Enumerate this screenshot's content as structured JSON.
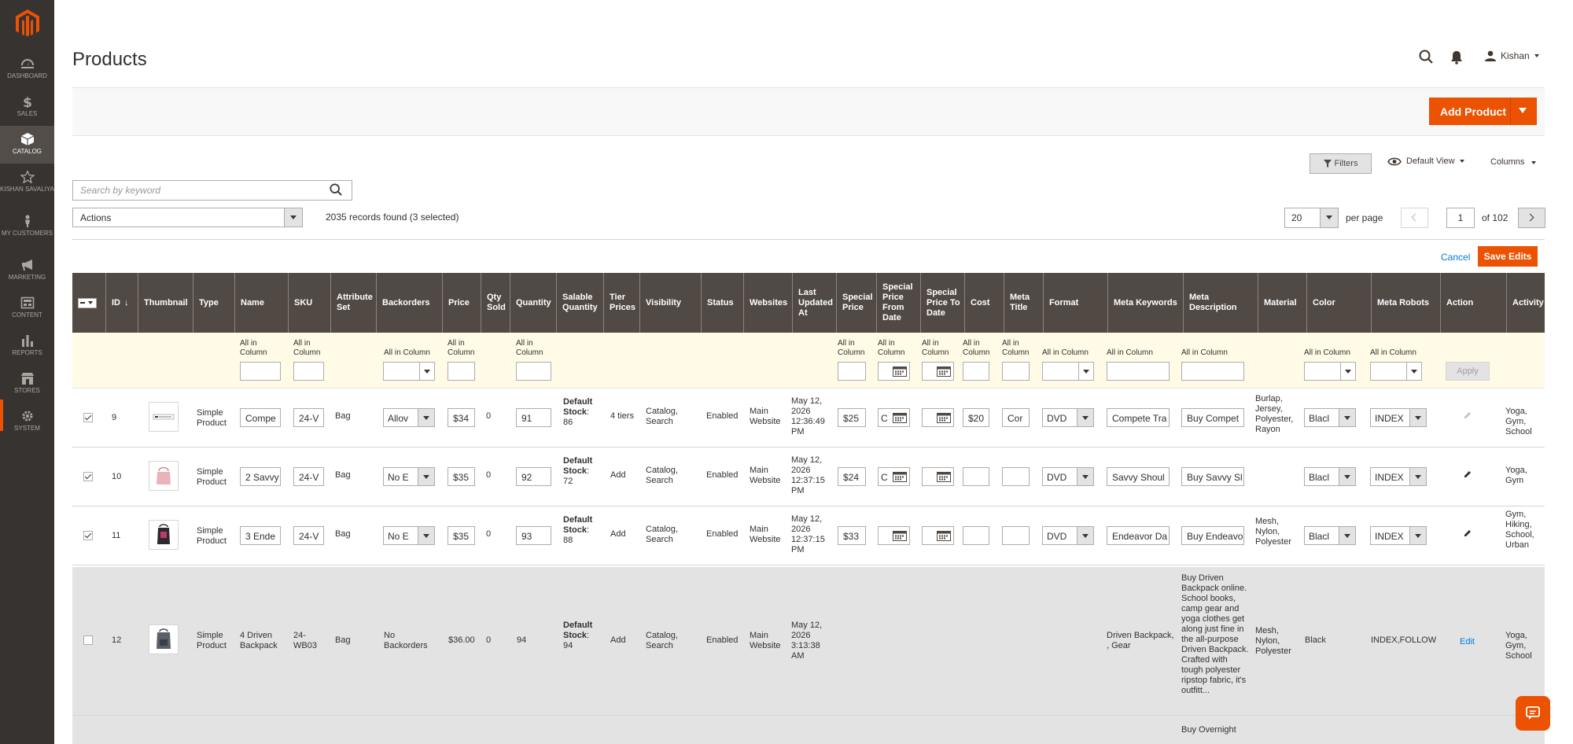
{
  "sidebar": {
    "items": [
      {
        "label": "DASHBOARD",
        "icon": "dashboard-icon"
      },
      {
        "label": "SALES",
        "icon": "dollar-icon"
      },
      {
        "label": "CATALOG",
        "icon": "box-icon"
      },
      {
        "label": "KISHAN SAVALIYA",
        "icon": "star-icon"
      },
      {
        "label": "MY CUSTOMERS",
        "icon": "person-icon"
      },
      {
        "label": "MARKETING",
        "icon": "megaphone-icon"
      },
      {
        "label": "CONTENT",
        "icon": "layout-icon"
      },
      {
        "label": "REPORTS",
        "icon": "bar-chart-icon"
      },
      {
        "label": "STORES",
        "icon": "store-icon"
      },
      {
        "label": "SYSTEM",
        "icon": "gear-icon"
      }
    ]
  },
  "header": {
    "title": "Products",
    "user": "Kishan"
  },
  "actions": {
    "add_product": "Add Product"
  },
  "toolbar": {
    "filters": "Filters",
    "view": "Default View",
    "columns": "Columns",
    "search_placeholder": "Search by keyword",
    "mass_action": "Actions",
    "records": "2035 records found (3 selected)",
    "per_page_value": "20",
    "per_page_label": "per page",
    "page": "1",
    "of_pages": "of 102",
    "cancel": "Cancel",
    "save_edits": "Save Edits"
  },
  "columns": [
    "ID",
    "Thumbnail",
    "Type",
    "Name",
    "SKU",
    "Attribute Set",
    "Backorders",
    "Price",
    "Qty Sold",
    "Quantity",
    "Salable Quantity",
    "Tier Prices",
    "Visibility",
    "Status",
    "Websites",
    "Last Updated At",
    "Special Price",
    "Special Price From Date",
    "Special Price To Date",
    "Cost",
    "Meta Title",
    "Format",
    "Meta Keywords",
    "Meta Description",
    "Material",
    "Color",
    "Meta Robots",
    "Action",
    "Activity"
  ],
  "filter_label": "All in Column",
  "filter_apply": "Apply",
  "rows": [
    {
      "checked": true,
      "id": "9",
      "type": "Simple Product",
      "name": "Compe",
      "sku": "24-V",
      "attr_set": "Bag",
      "backorders": "Allov",
      "price": "$34",
      "qty_sold": "0",
      "quantity": "91",
      "salable_label": "Default Stock",
      "salable_qty": ": 86",
      "tier_prices": "4 tiers",
      "visibility": "Catalog, Search",
      "status": "Enabled",
      "websites": "Main Website",
      "updated": "May 12, 2026 12:36:49 PM",
      "special_price": "$25",
      "sp_from": "C",
      "cost": "$20",
      "meta_title": "Cor",
      "format": "DVD",
      "meta_keywords": "Compete Tra",
      "meta_desc": "Buy Compet",
      "material": "Burlap, Jersey, Polyester, Rayon",
      "color": "Blacl",
      "robots": "INDEX",
      "activity": "Yoga, Gym, School"
    },
    {
      "checked": true,
      "id": "10",
      "type": "Simple Product",
      "name": "2 Savvy",
      "sku": "24-V",
      "attr_set": "Bag",
      "backorders": "No E",
      "price": "$35",
      "qty_sold": "0",
      "quantity": "92",
      "salable_label": "Default Stock",
      "salable_qty": ": 72",
      "tier_prices": "Add",
      "visibility": "Catalog, Search",
      "status": "Enabled",
      "websites": "Main Website",
      "updated": "May 12, 2026 12:37:15 PM",
      "special_price": "$24",
      "sp_from": "C",
      "cost": "",
      "meta_title": "",
      "format": "DVD",
      "meta_keywords": "Savvy Shoul",
      "meta_desc": "Buy Savvy Sl",
      "material": "",
      "color": "Blacl",
      "robots": "INDEX",
      "activity": "Yoga, Gym"
    },
    {
      "checked": true,
      "id": "11",
      "type": "Simple Product",
      "name": "3 Ende",
      "sku": "24-V",
      "attr_set": "Bag",
      "backorders": "No E",
      "price": "$35",
      "qty_sold": "0",
      "quantity": "93",
      "salable_label": "Default Stock",
      "salable_qty": ": 88",
      "tier_prices": "Add",
      "visibility": "Catalog, Search",
      "status": "Enabled",
      "websites": "Main Website",
      "updated": "May 12, 2026 12:37:15 PM",
      "special_price": "$33",
      "sp_from": "",
      "cost": "",
      "meta_title": "",
      "format": "DVD",
      "meta_keywords": "Endeavor Da",
      "meta_desc": "Buy Endeavo",
      "material": "Mesh, Nylon, Polyester",
      "color": "Blacl",
      "robots": "INDEX",
      "activity": "Gym, Hiking, School, Urban"
    },
    {
      "checked": false,
      "id": "12",
      "type": "Simple Product",
      "name": "4 Driven Backpack",
      "sku": "24-WB03",
      "attr_set": "Bag",
      "backorders": "No Backorders",
      "price": "$36.00",
      "qty_sold": "0",
      "quantity": "94",
      "salable_label": "Default Stock",
      "salable_qty": ": 94",
      "tier_prices": "Add",
      "visibility": "Catalog, Search",
      "status": "Enabled",
      "websites": "Main Website",
      "updated": "May 12, 2026 3:13:38 AM",
      "meta_keywords": "Driven Backpack, , Gear",
      "meta_desc": "Buy Driven Backpack online. School books, camp gear and yoga clothes get along just fine in the all-purpose Driven Backpack. Crafted with tough polyester ripstop fabric, it's outfitt...",
      "material": "Mesh, Nylon, Polyester",
      "color": "Black",
      "robots": "INDEX,FOLLOW",
      "action": "Edit",
      "activity": "Yoga, Gym, School"
    }
  ],
  "next_row_peek": "Buy Overnight"
}
